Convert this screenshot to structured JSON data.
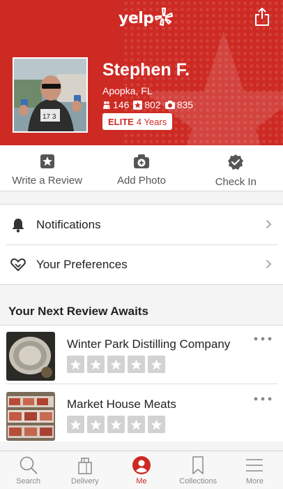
{
  "header": {
    "logo_text": "yelp",
    "share_icon": "share-icon",
    "background_color": "#cd2a24"
  },
  "profile": {
    "name": "Stephen F.",
    "location": "Apopka, FL",
    "stats": {
      "friends": "146",
      "reviews": "802",
      "photos": "835"
    },
    "elite_label": "ELITE",
    "elite_years": "4 Years"
  },
  "actions": [
    {
      "label": "Write a Review",
      "icon": "star-square-icon"
    },
    {
      "label": "Add Photo",
      "icon": "camera-plus-icon"
    },
    {
      "label": "Check In",
      "icon": "check-badge-icon"
    }
  ],
  "menu": [
    {
      "label": "Notifications",
      "icon": "bell-icon"
    },
    {
      "label": "Your Preferences",
      "icon": "heart-icon"
    }
  ],
  "review_section": {
    "title": "Your Next Review Awaits",
    "businesses": [
      {
        "name": "Winter Park Distilling Company",
        "rating": 0
      },
      {
        "name": "Market House Meats",
        "rating": 0
      }
    ]
  },
  "tabs": [
    {
      "label": "Search",
      "icon": "search-icon",
      "active": false
    },
    {
      "label": "Delivery",
      "icon": "bag-icon",
      "active": false
    },
    {
      "label": "Me",
      "icon": "user-icon",
      "active": true
    },
    {
      "label": "Collections",
      "icon": "bookmark-icon",
      "active": false
    },
    {
      "label": "More",
      "icon": "menu-icon",
      "active": false
    }
  ],
  "colors": {
    "brand_red": "#cd2a24",
    "star_empty": "#d2d2d2",
    "tab_inactive": "#8a8a8a"
  }
}
